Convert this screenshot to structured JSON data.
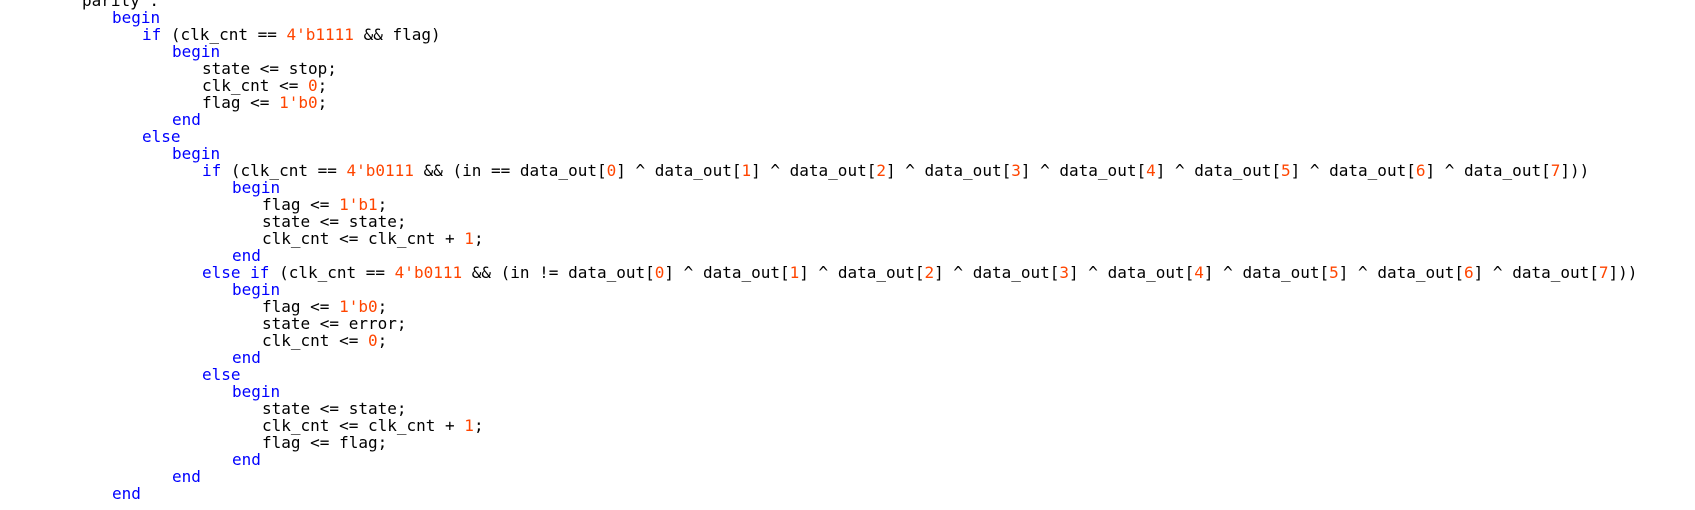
{
  "theme": {
    "keyword_color": "#0000ff",
    "number_color": "#ff4500",
    "text_color": "#000000",
    "background": "#ffffff"
  },
  "code": {
    "lines": [
      {
        "indent": 0,
        "tokens": [
          {
            "t": "parity :",
            "k": "plain"
          }
        ]
      },
      {
        "indent": 1,
        "tokens": [
          {
            "t": "begin",
            "k": "kw"
          }
        ]
      },
      {
        "indent": 2,
        "tokens": [
          {
            "t": "if",
            "k": "kw"
          },
          {
            "t": " (clk_cnt == ",
            "k": "plain"
          },
          {
            "t": "4'b1111",
            "k": "num"
          },
          {
            "t": " && flag)",
            "k": "plain"
          }
        ]
      },
      {
        "indent": 3,
        "tokens": [
          {
            "t": "begin",
            "k": "kw"
          }
        ]
      },
      {
        "indent": 4,
        "tokens": [
          {
            "t": "state <= stop;",
            "k": "plain"
          }
        ]
      },
      {
        "indent": 4,
        "tokens": [
          {
            "t": "clk_cnt <= ",
            "k": "plain"
          },
          {
            "t": "0",
            "k": "num"
          },
          {
            "t": ";",
            "k": "plain"
          }
        ]
      },
      {
        "indent": 4,
        "tokens": [
          {
            "t": "flag <= ",
            "k": "plain"
          },
          {
            "t": "1'b0",
            "k": "num"
          },
          {
            "t": ";",
            "k": "plain"
          }
        ]
      },
      {
        "indent": 3,
        "tokens": [
          {
            "t": "end",
            "k": "kw"
          }
        ]
      },
      {
        "indent": 2,
        "tokens": [
          {
            "t": "else",
            "k": "kw"
          }
        ]
      },
      {
        "indent": 3,
        "tokens": [
          {
            "t": "begin",
            "k": "kw"
          }
        ]
      },
      {
        "indent": 4,
        "tokens": [
          {
            "t": "if",
            "k": "kw"
          },
          {
            "t": " (clk_cnt == ",
            "k": "plain"
          },
          {
            "t": "4'b0111",
            "k": "num"
          },
          {
            "t": " && (in == data_out[",
            "k": "plain"
          },
          {
            "t": "0",
            "k": "num"
          },
          {
            "t": "] ^ data_out[",
            "k": "plain"
          },
          {
            "t": "1",
            "k": "num"
          },
          {
            "t": "] ^ data_out[",
            "k": "plain"
          },
          {
            "t": "2",
            "k": "num"
          },
          {
            "t": "] ^ data_out[",
            "k": "plain"
          },
          {
            "t": "3",
            "k": "num"
          },
          {
            "t": "] ^ data_out[",
            "k": "plain"
          },
          {
            "t": "4",
            "k": "num"
          },
          {
            "t": "] ^ data_out[",
            "k": "plain"
          },
          {
            "t": "5",
            "k": "num"
          },
          {
            "t": "] ^ data_out[",
            "k": "plain"
          },
          {
            "t": "6",
            "k": "num"
          },
          {
            "t": "] ^ data_out[",
            "k": "plain"
          },
          {
            "t": "7",
            "k": "num"
          },
          {
            "t": "]))",
            "k": "plain"
          }
        ]
      },
      {
        "indent": 5,
        "tokens": [
          {
            "t": "begin",
            "k": "kw"
          }
        ]
      },
      {
        "indent": 6,
        "tokens": [
          {
            "t": "flag <= ",
            "k": "plain"
          },
          {
            "t": "1'b1",
            "k": "num"
          },
          {
            "t": ";",
            "k": "plain"
          }
        ]
      },
      {
        "indent": 6,
        "tokens": [
          {
            "t": "state <= state;",
            "k": "plain"
          }
        ]
      },
      {
        "indent": 6,
        "tokens": [
          {
            "t": "clk_cnt <= clk_cnt + ",
            "k": "plain"
          },
          {
            "t": "1",
            "k": "num"
          },
          {
            "t": ";",
            "k": "plain"
          }
        ]
      },
      {
        "indent": 5,
        "tokens": [
          {
            "t": "end",
            "k": "kw"
          }
        ]
      },
      {
        "indent": 4,
        "tokens": [
          {
            "t": "else if",
            "k": "kw"
          },
          {
            "t": " (clk_cnt == ",
            "k": "plain"
          },
          {
            "t": "4'b0111",
            "k": "num"
          },
          {
            "t": " && (in != data_out[",
            "k": "plain"
          },
          {
            "t": "0",
            "k": "num"
          },
          {
            "t": "] ^ data_out[",
            "k": "plain"
          },
          {
            "t": "1",
            "k": "num"
          },
          {
            "t": "] ^ data_out[",
            "k": "plain"
          },
          {
            "t": "2",
            "k": "num"
          },
          {
            "t": "] ^ data_out[",
            "k": "plain"
          },
          {
            "t": "3",
            "k": "num"
          },
          {
            "t": "] ^ data_out[",
            "k": "plain"
          },
          {
            "t": "4",
            "k": "num"
          },
          {
            "t": "] ^ data_out[",
            "k": "plain"
          },
          {
            "t": "5",
            "k": "num"
          },
          {
            "t": "] ^ data_out[",
            "k": "plain"
          },
          {
            "t": "6",
            "k": "num"
          },
          {
            "t": "] ^ data_out[",
            "k": "plain"
          },
          {
            "t": "7",
            "k": "num"
          },
          {
            "t": "]))",
            "k": "plain"
          }
        ]
      },
      {
        "indent": 5,
        "tokens": [
          {
            "t": "begin",
            "k": "kw"
          }
        ]
      },
      {
        "indent": 6,
        "tokens": [
          {
            "t": "flag <= ",
            "k": "plain"
          },
          {
            "t": "1'b0",
            "k": "num"
          },
          {
            "t": ";",
            "k": "plain"
          }
        ]
      },
      {
        "indent": 6,
        "tokens": [
          {
            "t": "state <= error;",
            "k": "plain"
          }
        ]
      },
      {
        "indent": 6,
        "tokens": [
          {
            "t": "clk_cnt <= ",
            "k": "plain"
          },
          {
            "t": "0",
            "k": "num"
          },
          {
            "t": ";",
            "k": "plain"
          }
        ]
      },
      {
        "indent": 5,
        "tokens": [
          {
            "t": "end",
            "k": "kw"
          }
        ]
      },
      {
        "indent": 4,
        "tokens": [
          {
            "t": "else",
            "k": "kw"
          }
        ]
      },
      {
        "indent": 5,
        "tokens": [
          {
            "t": "begin",
            "k": "kw"
          }
        ]
      },
      {
        "indent": 6,
        "tokens": [
          {
            "t": "state <= state;",
            "k": "plain"
          }
        ]
      },
      {
        "indent": 6,
        "tokens": [
          {
            "t": "clk_cnt <= clk_cnt + ",
            "k": "plain"
          },
          {
            "t": "1",
            "k": "num"
          },
          {
            "t": ";",
            "k": "plain"
          }
        ]
      },
      {
        "indent": 6,
        "tokens": [
          {
            "t": "flag <= flag;",
            "k": "plain"
          }
        ]
      },
      {
        "indent": 5,
        "tokens": [
          {
            "t": "end",
            "k": "kw"
          }
        ]
      },
      {
        "indent": 3,
        "tokens": [
          {
            "t": "end",
            "k": "kw"
          }
        ]
      },
      {
        "indent": 1,
        "tokens": [
          {
            "t": "end",
            "k": "kw"
          }
        ]
      }
    ]
  }
}
